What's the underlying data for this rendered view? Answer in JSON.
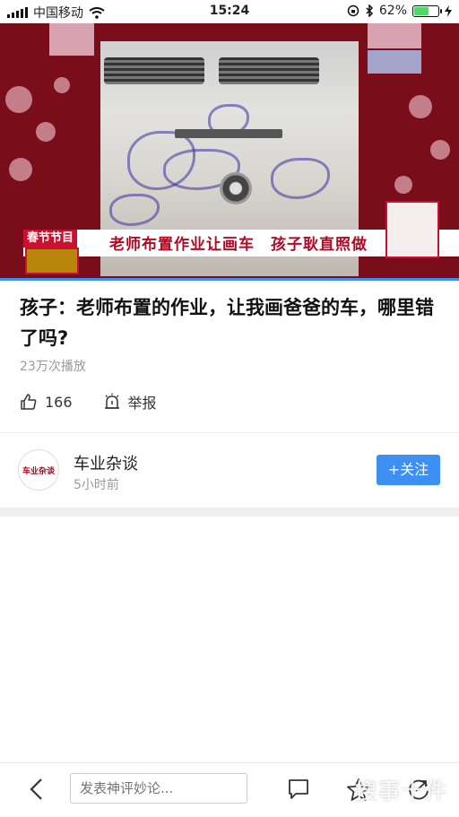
{
  "status_bar": {
    "carrier": "中国移动",
    "time": "15:24",
    "battery_percent_text": "62%",
    "battery_level": 0.62
  },
  "video": {
    "program_tag": "春节节目",
    "caption": "老师布置作业让画车　孩子耿直照做",
    "progress_color": "#3c8ff5"
  },
  "article": {
    "title": "孩子：老师布置的作业，让我画爸爸的车，哪里错了吗?",
    "plays": "23万次播放",
    "like_count": "166",
    "report_label": "举报"
  },
  "author": {
    "name": "车业杂谈",
    "time_ago": "5小时前",
    "follow_label": "+关注"
  },
  "bottom_bar": {
    "comment_placeholder": "发表神评妙论..."
  },
  "watermark": "搜事十件",
  "colors": {
    "accent": "#3d8ff2",
    "red": "#c9102f"
  }
}
